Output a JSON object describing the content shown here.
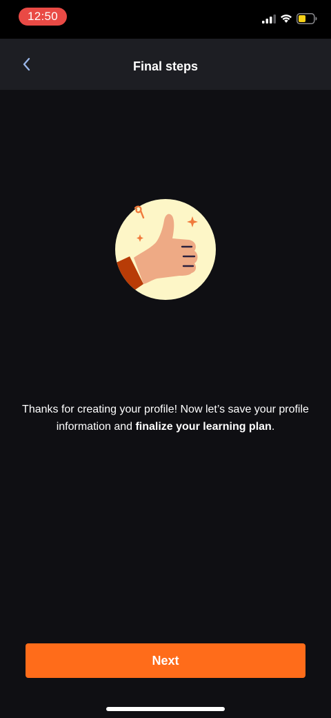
{
  "status_bar": {
    "time": "12:50",
    "time_pill_color": "#e94a45",
    "battery_color": "#f7d117"
  },
  "nav": {
    "back_icon": "chevron-left-icon",
    "title": "Final steps"
  },
  "illustration": {
    "icon": "thumbs-up-icon",
    "circle_color": "#fdf6c7",
    "hand_color": "#eeaa85",
    "sleeve_color": "#b83c07",
    "sparkle_color": "#f07a3c"
  },
  "message": {
    "text_before": "Thanks for creating your profile! Now let’s save your profile information and ",
    "text_bold": "finalize your learning plan",
    "text_after": "."
  },
  "primary_action": {
    "label": "Next",
    "color": "#ff6c1a"
  }
}
